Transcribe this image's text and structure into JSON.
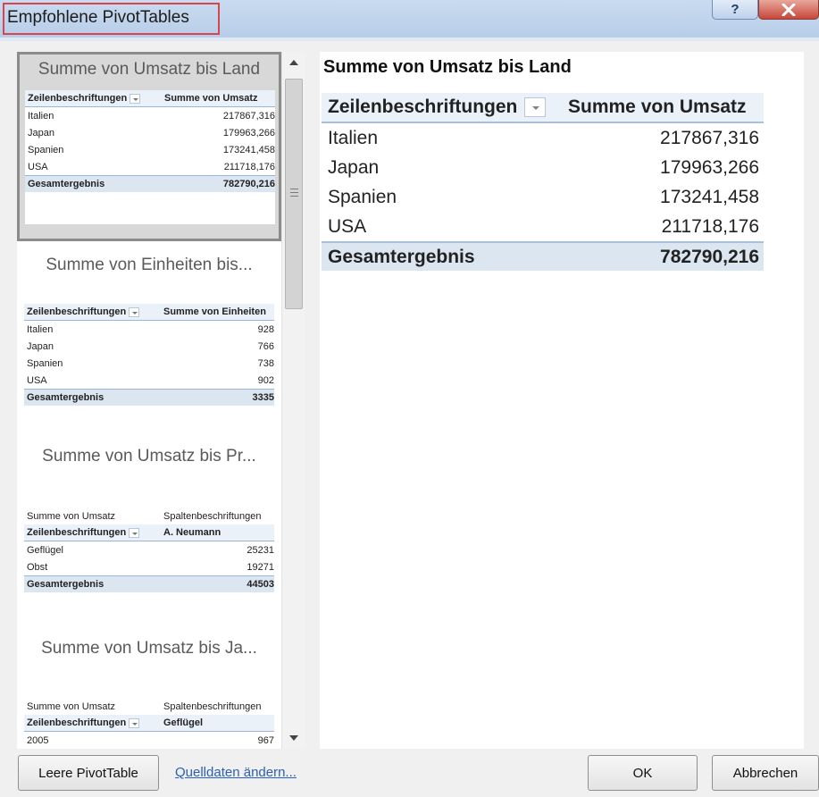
{
  "window": {
    "title": "Empfohlene PivotTables",
    "help_glyph": "?"
  },
  "recommendations": [
    {
      "title": "Summe von Umsatz bis Land",
      "selected": true,
      "rows": [
        {
          "type": "hdr",
          "c1": "Zeilenbeschriftungen",
          "c2": "Summe von Umsatz",
          "dropdown": true
        },
        {
          "type": "row",
          "c1": "Italien",
          "c2": "217867,316"
        },
        {
          "type": "row",
          "c1": "Japan",
          "c2": "179963,266"
        },
        {
          "type": "row",
          "c1": "Spanien",
          "c2": "173241,458"
        },
        {
          "type": "row",
          "c1": "USA",
          "c2": "211718,176"
        },
        {
          "type": "tot",
          "c1": "Gesamtergebnis",
          "c2": "782790,216"
        }
      ]
    },
    {
      "title": "Summe von Einheiten bis...",
      "selected": false,
      "rows": [
        {
          "type": "hdr",
          "c1": "Zeilenbeschriftungen",
          "c2": "Summe von Einheiten",
          "dropdown": true
        },
        {
          "type": "row",
          "c1": "Italien",
          "c2": "928"
        },
        {
          "type": "row",
          "c1": "Japan",
          "c2": "766"
        },
        {
          "type": "row",
          "c1": "Spanien",
          "c2": "738"
        },
        {
          "type": "row",
          "c1": "USA",
          "c2": "902"
        },
        {
          "type": "tot",
          "c1": "Gesamtergebnis",
          "c2": "3335"
        }
      ]
    },
    {
      "title": "Summe von Umsatz bis Pr...",
      "selected": false,
      "rows": [
        {
          "type": "lbl",
          "c1": "Summe von Umsatz",
          "c2": "Spaltenbeschriftungen"
        },
        {
          "type": "hdr",
          "c1": "Zeilenbeschriftungen",
          "c2": "A. Neumann",
          "dropdown": true
        },
        {
          "type": "row",
          "c1": "Geflügel",
          "c2": "25231"
        },
        {
          "type": "row",
          "c1": "Obst",
          "c2": "19271"
        },
        {
          "type": "tot",
          "c1": "Gesamtergebnis",
          "c2": "44503"
        }
      ]
    },
    {
      "title": "Summe von Umsatz bis Ja...",
      "selected": false,
      "rows": [
        {
          "type": "lbl",
          "c1": "Summe von Umsatz",
          "c2": "Spaltenbeschriftungen"
        },
        {
          "type": "hdr",
          "c1": "Zeilenbeschriftungen",
          "c2": "Geflügel",
          "dropdown": true
        },
        {
          "type": "row",
          "c1": "2005",
          "c2": "967"
        }
      ]
    }
  ],
  "preview": {
    "title": "Summe von Umsatz bis Land",
    "header": {
      "c1": "Zeilenbeschriftungen",
      "c2": "Summe von Umsatz"
    },
    "rows": [
      {
        "c1": "Italien",
        "c2": "217867,316"
      },
      {
        "c1": "Japan",
        "c2": "179963,266"
      },
      {
        "c1": "Spanien",
        "c2": "173241,458"
      },
      {
        "c1": "USA",
        "c2": "211718,176"
      }
    ],
    "total": {
      "c1": "Gesamtergebnis",
      "c2": "782790,216"
    }
  },
  "footer": {
    "empty_pivot_label": "Leere PivotTable",
    "change_source_link": "Quelldaten ändern...",
    "ok_label": "OK",
    "cancel_label": "Abbrechen"
  }
}
